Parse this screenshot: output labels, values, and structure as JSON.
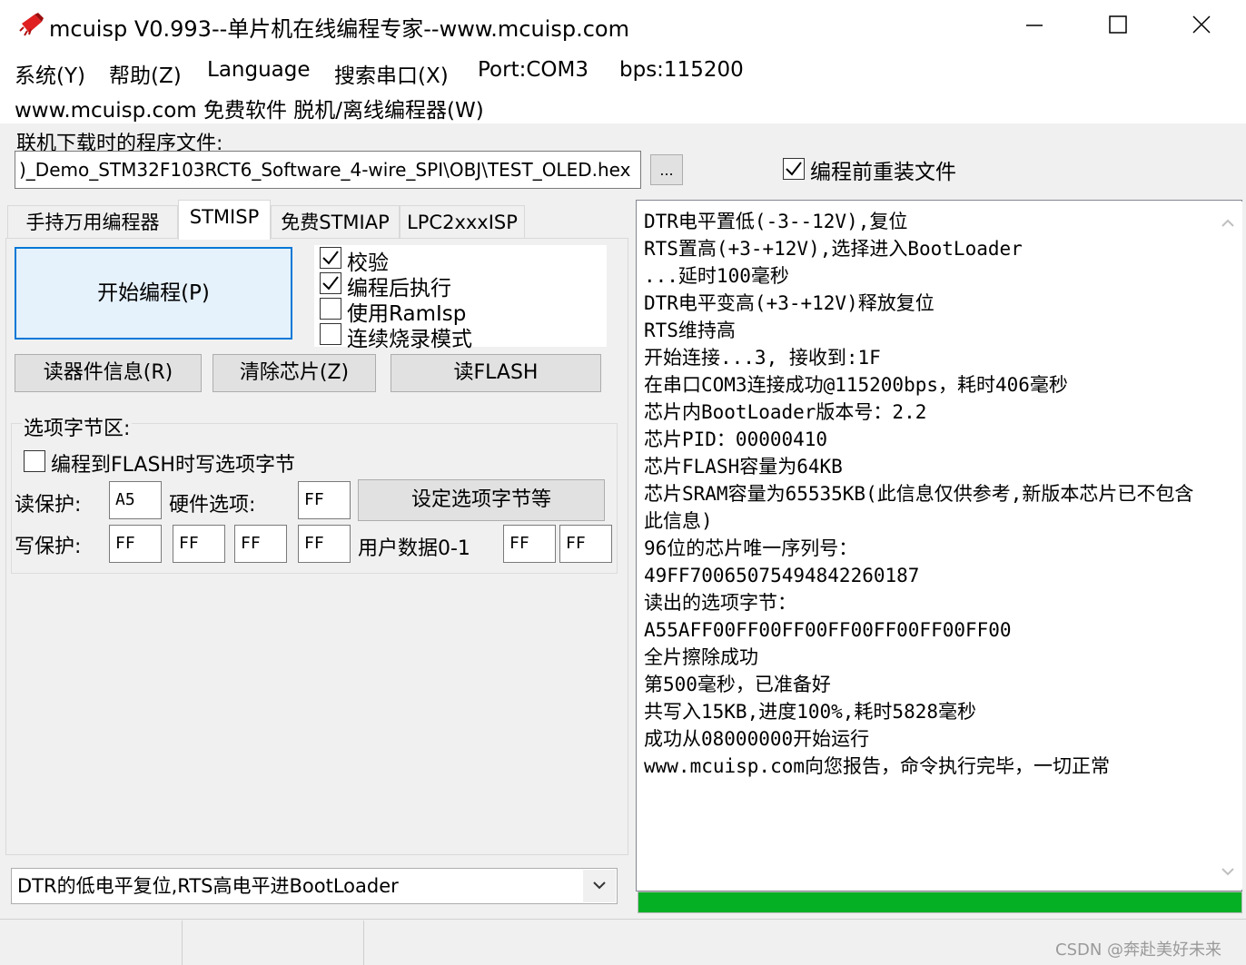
{
  "window": {
    "title": "mcuisp V0.993--单片机在线编程专家--www.mcuisp.com"
  },
  "menu": {
    "items": [
      "系统(Y)",
      "帮助(Z)",
      "Language",
      "搜索串口(X)",
      "Port:COM3",
      "bps:115200"
    ],
    "sub_item": "www.mcuisp.com 免费软件 脱机/离线编程器(W)"
  },
  "file": {
    "label": "联机下载时的程序文件:",
    "path": ")_Demo_STM32F103RCT6_Software_4-wire_SPI\\OBJ\\TEST_OLED.hex",
    "browse_label": "...",
    "reload_label": "编程前重装文件",
    "reload_checked": true
  },
  "tabs": [
    "手持万用编程器",
    "STMISP",
    "免费STMIAP",
    "LPC2xxxISP"
  ],
  "active_tab": "STMISP",
  "program": {
    "start_label": "开始编程(P)",
    "checks": [
      {
        "label": "校验",
        "checked": true
      },
      {
        "label": "编程后执行",
        "checked": true
      },
      {
        "label": "使用RamIsp",
        "checked": false
      },
      {
        "label": "连续烧录模式",
        "checked": false
      }
    ],
    "read_info_label": "读器件信息(R)",
    "erase_label": "清除芯片(Z)",
    "read_flash_label": "读FLASH"
  },
  "options": {
    "title": "选项字节区:",
    "write_option_label": "编程到FLASH时写选项字节",
    "write_option_checked": false,
    "read_protect_label": "读保护:",
    "read_protect_value": "A5",
    "hw_option_label": "硬件选项:",
    "hw_option_value": "FF",
    "set_button_label": "设定选项字节等",
    "write_protect_label": "写保护:",
    "write_protect_values": [
      "FF",
      "FF",
      "FF",
      "FF"
    ],
    "user_data_label": "用户数据0-1",
    "user_data_values": [
      "FF",
      "FF"
    ]
  },
  "reset_mode": {
    "selected": "DTR的低电平复位,RTS高电平进BootLoader"
  },
  "log": {
    "lines": [
      "DTR电平置低(-3--12V),复位",
      "RTS置高(+3-+12V),选择进入BootLoader",
      "...延时100毫秒",
      "DTR电平变高(+3-+12V)释放复位",
      "RTS维持高",
      "开始连接...3, 接收到:1F",
      "在串口COM3连接成功@115200bps，耗时406毫秒",
      "芯片内BootLoader版本号：2.2",
      "芯片PID：00000410",
      "芯片FLASH容量为64KB",
      "芯片SRAM容量为65535KB(此信息仅供参考,新版本芯片已不包含此信息)",
      "96位的芯片唯一序列号：",
      "49FF70065075494842260187",
      "读出的选项字节：",
      "A55AFF00FF00FF00FF00FF00FF00FF00",
      "全片擦除成功",
      "第500毫秒，已准备好",
      "共写入15KB,进度100%,耗时5828毫秒",
      "成功从08000000开始运行",
      "www.mcuisp.com向您报告，命令执行完毕，一切正常"
    ]
  },
  "progress": {
    "fraction": 1.0,
    "color": "#06b025"
  },
  "watermark": "CSDN @奔赴美好未来",
  "icons": {
    "app": "chip-icon",
    "minimize": "minimize-icon",
    "maximize": "maximize-icon",
    "close": "close-icon",
    "dropdown": "chevron-down-icon",
    "scroll_up": "chevron-up-icon",
    "scroll_down": "chevron-down-icon"
  }
}
